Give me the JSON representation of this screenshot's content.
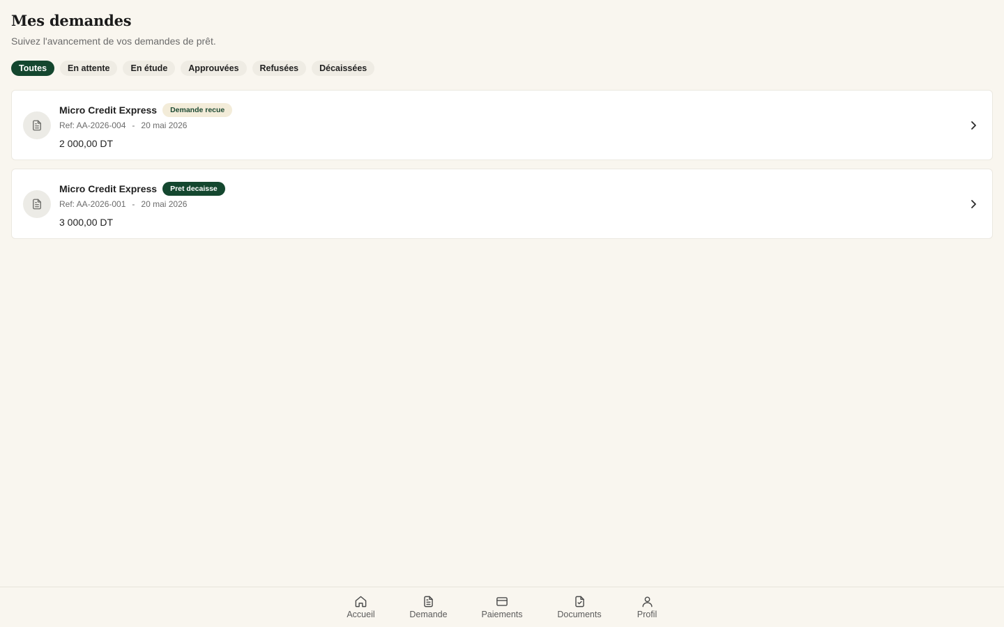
{
  "header": {
    "title": "Mes demandes",
    "subtitle": "Suivez l'avancement de vos demandes de prêt."
  },
  "filters": [
    {
      "label": "Toutes",
      "active": true
    },
    {
      "label": "En attente",
      "active": false
    },
    {
      "label": "En étude",
      "active": false
    },
    {
      "label": "Approuvées",
      "active": false
    },
    {
      "label": "Refusées",
      "active": false
    },
    {
      "label": "Décaissées",
      "active": false
    }
  ],
  "requests": [
    {
      "icon": "document-icon",
      "title": "Micro Credit Express",
      "status": "Demande recue",
      "ref": "Ref: AA-2026-004",
      "separator": "-",
      "date": "20 mai 2026",
      "amount": "2 000,00 DT"
    },
    {
      "icon": "document-icon",
      "title": "Micro Credit Express",
      "status": "Pret decaisse",
      "ref": "Ref: AA-2026-001",
      "separator": "-",
      "date": "20 mai 2026",
      "amount": "3 000,00 DT"
    }
  ],
  "bottom_nav": [
    {
      "label": "Accueil",
      "icon": "home-icon"
    },
    {
      "label": "Demande",
      "icon": "document-icon"
    },
    {
      "label": "Paiements",
      "icon": "credit-card-icon"
    },
    {
      "label": "Documents",
      "icon": "file-check-icon"
    },
    {
      "label": "Profil",
      "icon": "user-icon"
    }
  ],
  "colors": {
    "background": "#f9f6ef",
    "accent": "#14472f",
    "badge_received_bg": "#f3ecd9",
    "card_bg": "#ffffff"
  }
}
